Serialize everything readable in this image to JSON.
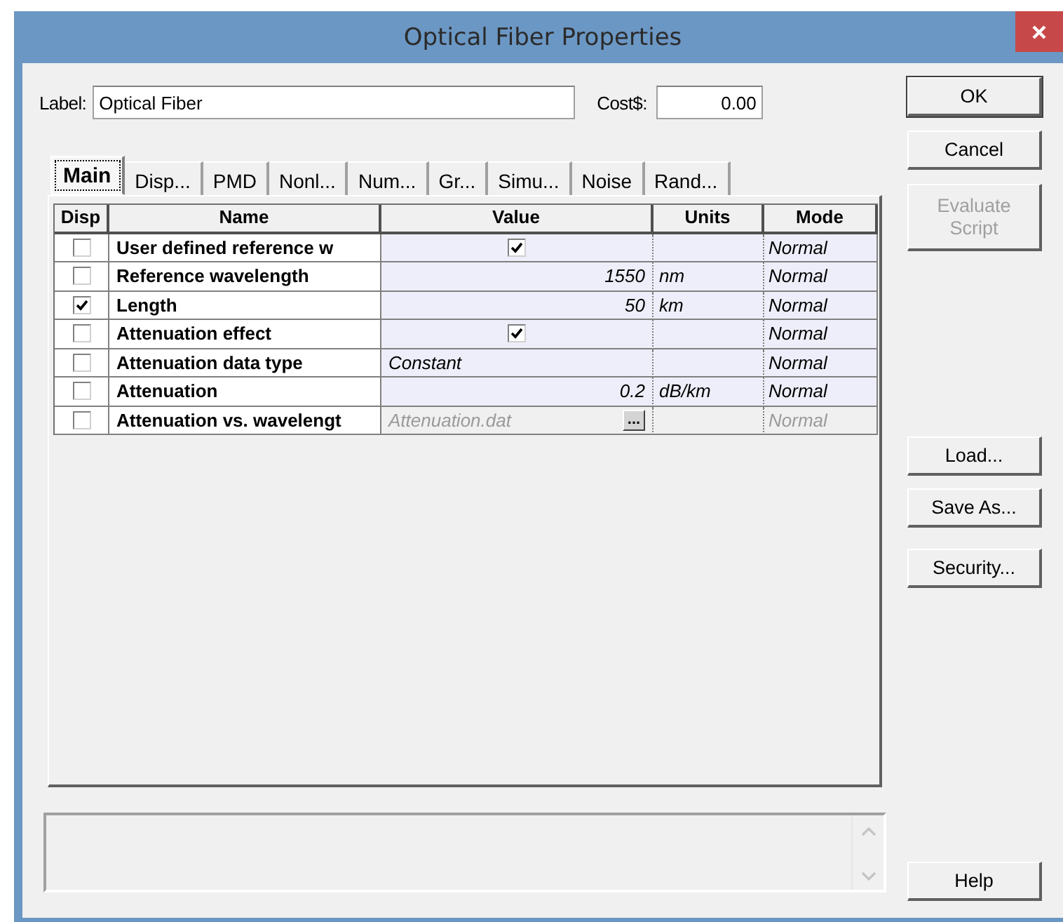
{
  "window": {
    "title": "Optical Fiber Properties"
  },
  "label_field": {
    "label": "Label:",
    "value": "Optical Fiber"
  },
  "cost_field": {
    "label": "Cost$:",
    "value": "0.00"
  },
  "tabs": [
    {
      "label": "Main",
      "selected": true
    },
    {
      "label": "Disp...",
      "selected": false
    },
    {
      "label": "PMD",
      "selected": false
    },
    {
      "label": "Nonl...",
      "selected": false
    },
    {
      "label": "Num...",
      "selected": false
    },
    {
      "label": "Gr...",
      "selected": false
    },
    {
      "label": "Simu...",
      "selected": false
    },
    {
      "label": "Noise",
      "selected": false
    },
    {
      "label": "Rand...",
      "selected": false
    }
  ],
  "table": {
    "columns": [
      "Disp",
      "Name",
      "Value",
      "Units",
      "Mode"
    ],
    "rows": [
      {
        "disp_checked": false,
        "name": "User defined reference w",
        "value": {
          "kind": "checkbox",
          "checked": true
        },
        "mode": "Normal",
        "disabled": false
      },
      {
        "disp_checked": false,
        "name": "Reference wavelength",
        "value": {
          "kind": "number",
          "text": "1550"
        },
        "units": "nm",
        "mode": "Normal",
        "disabled": false
      },
      {
        "disp_checked": true,
        "name": "Length",
        "value": {
          "kind": "number",
          "text": "50"
        },
        "units": "km",
        "mode": "Normal",
        "disabled": false
      },
      {
        "disp_checked": false,
        "name": "Attenuation effect",
        "value": {
          "kind": "checkbox",
          "checked": true
        },
        "mode": "Normal",
        "disabled": false
      },
      {
        "disp_checked": false,
        "name": "Attenuation data type",
        "value": {
          "kind": "text",
          "text": "Constant"
        },
        "mode": "Normal",
        "disabled": false
      },
      {
        "disp_checked": false,
        "name": "Attenuation",
        "value": {
          "kind": "number",
          "text": "0.2"
        },
        "units": "dB/km",
        "mode": "Normal",
        "disabled": false
      },
      {
        "disp_checked": false,
        "name": "Attenuation vs. wavelengt",
        "value": {
          "kind": "file",
          "text": "Attenuation.dat",
          "button": "..."
        },
        "mode": "Normal",
        "disabled": true
      }
    ]
  },
  "top_buttons": [
    {
      "label": "OK",
      "disabled": false,
      "default": true
    },
    {
      "label": "Cancel",
      "disabled": false,
      "default": false
    },
    {
      "label": "Evaluate Script",
      "disabled": true,
      "default": false
    }
  ],
  "file_buttons": [
    {
      "label": "Load...",
      "disabled": false
    },
    {
      "label": "Save As...",
      "disabled": false
    },
    {
      "label": "Security...",
      "disabled": false
    }
  ],
  "help_button": {
    "label": "Help",
    "disabled": false
  }
}
